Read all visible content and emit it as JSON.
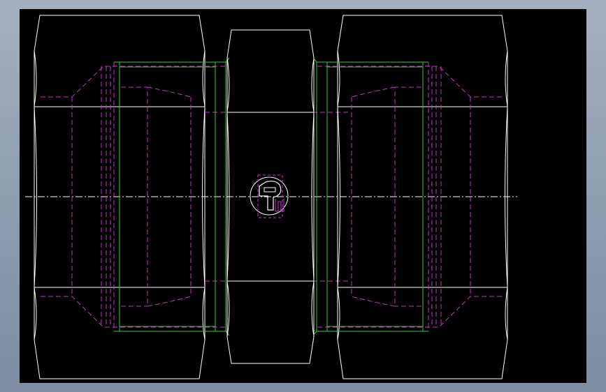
{
  "viewport": {
    "background": "#000000",
    "frame_background": "#96a4b8"
  },
  "colors": {
    "visible_edge": "#ffffff",
    "hidden_line": "#cc33cc",
    "thread_line": "#33cc33",
    "center_line": "#ffffff"
  },
  "drawing": {
    "view": "front-view",
    "parts": [
      "left-hex-nut",
      "center-hex-body",
      "right-hex-nut"
    ],
    "logo_icon": "parker-p-logo-icon"
  }
}
